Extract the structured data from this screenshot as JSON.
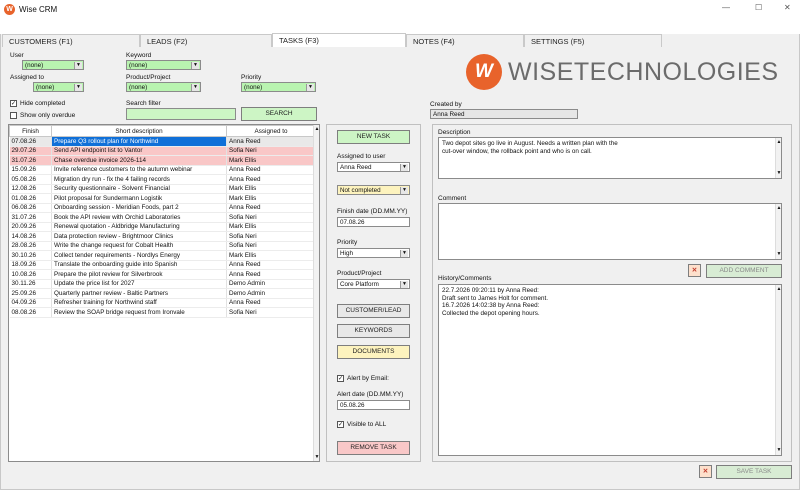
{
  "app": {
    "title": "Wise CRM",
    "logo_text": "WISETECHNOLOGIES",
    "logo_initials": "W"
  },
  "window_controls": {
    "minimize": "—",
    "maximize": "☐",
    "close": "✕"
  },
  "tabs": [
    {
      "label": "CUSTOMERS (F1)",
      "active": false
    },
    {
      "label": "LEADS (F2)",
      "active": false
    },
    {
      "label": "TASKS (F3)",
      "active": true
    },
    {
      "label": "NOTES (F4)",
      "active": false
    },
    {
      "label": "SETTINGS (F5)",
      "active": false
    }
  ],
  "filters": {
    "user_label": "User",
    "user_value": "(none)",
    "keyword_label": "Keyword",
    "keyword_value": "(none)",
    "assigned_label": "Assigned to",
    "assigned_value": "(none)",
    "product_label": "Product/Project",
    "product_value": "(none)",
    "priority_label": "Priority",
    "priority_value": "(none)",
    "hide_completed_label": "Hide completed",
    "hide_completed_checked": true,
    "show_overdue_label": "Show only overdue",
    "show_overdue_checked": false,
    "search_label": "Search filter",
    "search_value": "",
    "search_button": "SEARCH"
  },
  "table": {
    "columns": [
      "Finish",
      "Short description",
      "Assigned to"
    ],
    "rows": [
      {
        "finish": "07.08.26",
        "desc": "Prepare Q3 rollout plan for Northwind",
        "assigned": "Anna Reed",
        "state": "selected"
      },
      {
        "finish": "29.07.26",
        "desc": "Send API endpoint list to Vantor",
        "assigned": "Sofia Neri",
        "state": "overdue"
      },
      {
        "finish": "31.07.26",
        "desc": "Chase overdue invoice 2026-114",
        "assigned": "Mark Ellis",
        "state": "overdue"
      },
      {
        "finish": "15.09.26",
        "desc": "Invite reference customers to the autumn webinar",
        "assigned": "Anna Reed",
        "state": ""
      },
      {
        "finish": "05.08.26",
        "desc": "Migration dry run - fix the 4 failing records",
        "assigned": "Anna Reed",
        "state": ""
      },
      {
        "finish": "12.08.26",
        "desc": "Security questionnaire - Solvent Financial",
        "assigned": "Mark Ellis",
        "state": ""
      },
      {
        "finish": "01.08.26",
        "desc": "Pilot proposal for Sundermann Logistik",
        "assigned": "Mark Ellis",
        "state": ""
      },
      {
        "finish": "06.08.26",
        "desc": "Onboarding session - Meridian Foods, part 2",
        "assigned": "Anna Reed",
        "state": ""
      },
      {
        "finish": "31.07.26",
        "desc": "Book the API review with Orchid Laboratories",
        "assigned": "Sofia Neri",
        "state": ""
      },
      {
        "finish": "20.09.26",
        "desc": "Renewal quotation - Aldbridge Manufacturing",
        "assigned": "Mark Ellis",
        "state": ""
      },
      {
        "finish": "14.08.26",
        "desc": "Data protection review - Brightmoor Clinics",
        "assigned": "Sofia Neri",
        "state": ""
      },
      {
        "finish": "28.08.26",
        "desc": "Write the change request for Cobalt Health",
        "assigned": "Sofia Neri",
        "state": ""
      },
      {
        "finish": "30.10.26",
        "desc": "Collect tender requirements - Nordlys Energy",
        "assigned": "Mark Ellis",
        "state": ""
      },
      {
        "finish": "18.09.26",
        "desc": "Translate the onboarding guide into Spanish",
        "assigned": "Anna Reed",
        "state": ""
      },
      {
        "finish": "10.08.26",
        "desc": "Prepare the pilot review for Silverbrook",
        "assigned": "Anna Reed",
        "state": ""
      },
      {
        "finish": "30.11.26",
        "desc": "Update the price list for 2027",
        "assigned": "Demo Admin",
        "state": ""
      },
      {
        "finish": "25.09.26",
        "desc": "Quarterly partner review - Baltic Partners",
        "assigned": "Demo Admin",
        "state": ""
      },
      {
        "finish": "04.09.26",
        "desc": "Refresher training for Northwind staff",
        "assigned": "Anna Reed",
        "state": ""
      },
      {
        "finish": "08.08.26",
        "desc": "Review the SOAP bridge request from Ironvale",
        "assigned": "Sofia Neri",
        "state": ""
      }
    ]
  },
  "task_panel": {
    "new_task": "NEW TASK",
    "assigned_label": "Assigned to user",
    "assigned_value": "Anna Reed",
    "status_value": "Not completed",
    "finish_label": "Finish date (DD.MM.YY)",
    "finish_value": "07.08.26",
    "priority_label": "Priority",
    "priority_value": "High",
    "product_label": "Product/Project",
    "product_value": "Core Platform",
    "customer_lead": "CUSTOMER/LEAD",
    "keywords": "KEYWORDS",
    "documents": "DOCUMENTS",
    "alert_email_label": "Alert by Email:",
    "alert_email_checked": true,
    "alert_date_label": "Alert date (DD.MM.YY)",
    "alert_date_value": "05.08.26",
    "visible_all_label": "Visible to ALL",
    "visible_all_checked": true,
    "remove_task": "REMOVE TASK"
  },
  "detail": {
    "created_by_label": "Created by",
    "created_by_value": "Anna Reed",
    "description_label": "Description",
    "description_lines": [
      "Two depot sites go live in August. Needs a written plan with the",
      "cut-over window, the rollback point and who is on call."
    ],
    "comment_label": "Comment",
    "comment_value": "",
    "clear_icon": "✕",
    "add_comment": "ADD COMMENT",
    "history_label": "History/Comments",
    "history_lines": [
      "22.7.2026 09:20:11 by Anna Reed:",
      "Draft sent to James Holt for comment.",
      "16.7.2026 14:02:38 by Anna Reed:",
      "Collected the depot opening hours."
    ],
    "save_task": "SAVE TASK"
  },
  "colors": {
    "accent_green": "#cdf5c5",
    "combo_green": "#b9f4b0",
    "overdue_pink": "#f9c7c7",
    "selected_blue": "#1070d8",
    "logo_orange": "#e8632b",
    "logo_gray": "#6b6b6b"
  }
}
